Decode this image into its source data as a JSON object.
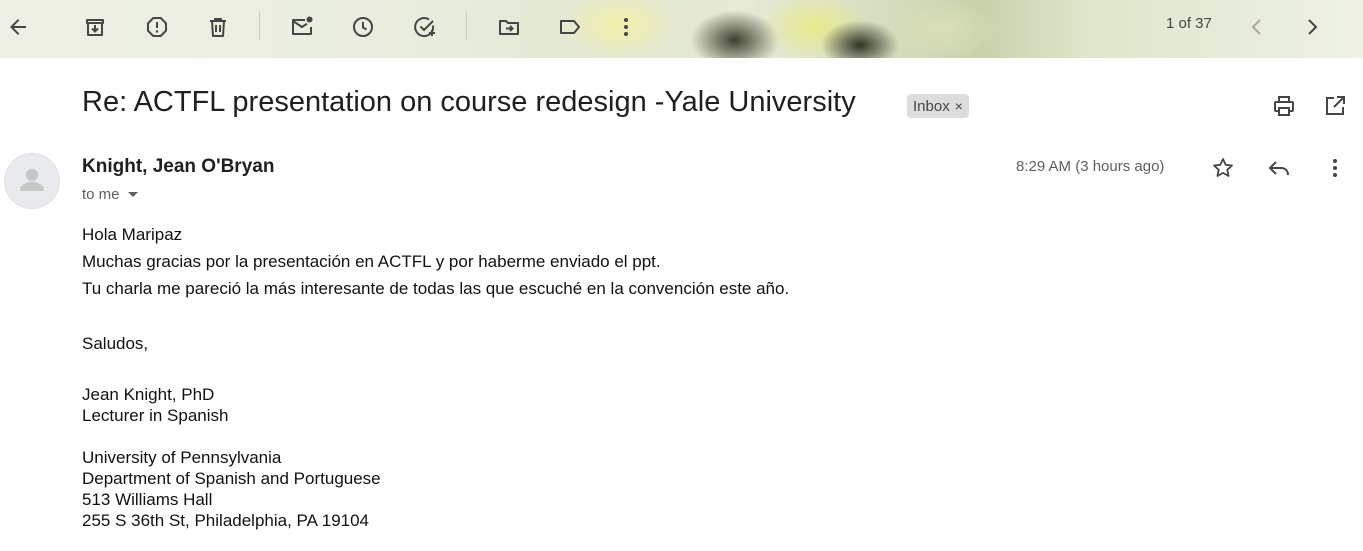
{
  "toolbar": {
    "buttons": [
      {
        "name": "back-button",
        "icon": "arrow-left-icon"
      },
      {
        "name": "archive-button",
        "icon": "archive-icon"
      },
      {
        "name": "report-spam-button",
        "icon": "report-icon"
      },
      {
        "name": "delete-button",
        "icon": "trash-icon"
      },
      {
        "name": "mark-unread-button",
        "icon": "mark-unread-icon"
      },
      {
        "name": "snooze-button",
        "icon": "clock-icon"
      },
      {
        "name": "add-task-button",
        "icon": "add-task-icon"
      },
      {
        "name": "move-to-button",
        "icon": "move-to-icon"
      },
      {
        "name": "labels-button",
        "icon": "label-icon"
      },
      {
        "name": "more-button",
        "icon": "more-vert-icon"
      }
    ],
    "pager_text": "1 of 37"
  },
  "message": {
    "subject": "Re: ACTFL presentation on course redesign -Yale University",
    "label": "Inbox",
    "label_close": "×",
    "sender": "Knight, Jean O'Bryan",
    "recipient": "to me",
    "time": "8:29 AM (3 hours ago)",
    "body": {
      "greeting": "Hola Maripaz",
      "line1": "Muchas gracias por la presentación en ACTFL y por haberme enviado el ppt.",
      "line2": "Tu charla me pareció la más interesante de todas las que escuché en la convención este año.",
      "closing": "Saludos,",
      "sig_name": "Jean Knight, PhD",
      "sig_title": "Lecturer in Spanish",
      "sig_univ": "University of Pennsylvania",
      "sig_dept": "Department of Spanish and Portuguese",
      "sig_office": "513 Williams Hall",
      "sig_address": "255 S 36th St, Philadelphia, PA 19104"
    }
  },
  "colors": {
    "icon": "#444746",
    "text": "#1f1f1f",
    "muted": "#5e5e5e",
    "chip": "#dddddd"
  }
}
